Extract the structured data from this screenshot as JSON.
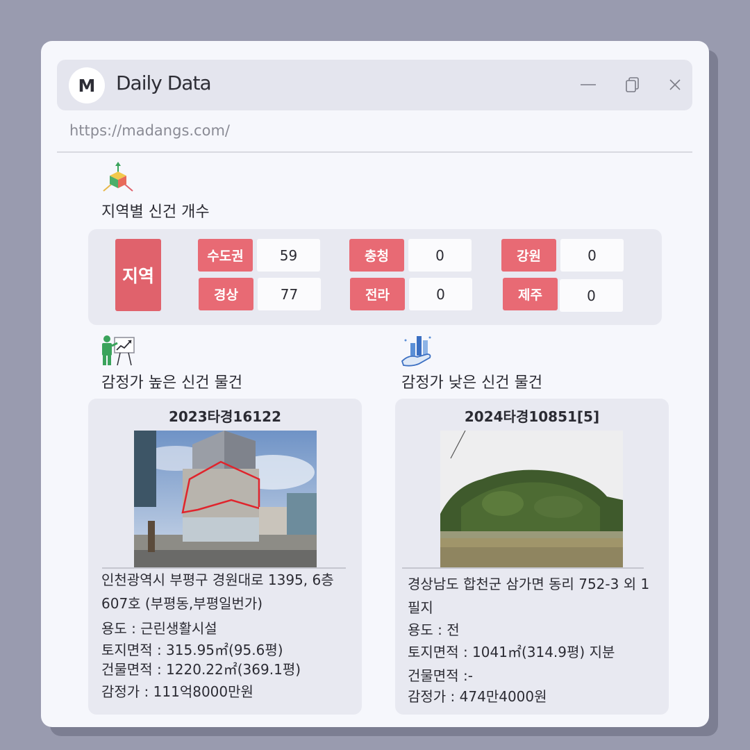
{
  "window": {
    "logo_letter": "M",
    "title": "Daily Data",
    "url": "https://madangs.com/"
  },
  "region_section": {
    "title": "지역별 신건 개수",
    "main_label": "지역",
    "regions": [
      {
        "label": "수도권",
        "value": "59"
      },
      {
        "label": "충청",
        "value": "0"
      },
      {
        "label": "강원",
        "value": "0"
      },
      {
        "label": "경상",
        "value": "77"
      },
      {
        "label": "전라",
        "value": "0"
      },
      {
        "label": "제주",
        "value": "0"
      }
    ]
  },
  "high_section": {
    "title": "감정가 높은 신건 물건",
    "case_no": "2023타경16122",
    "address_line1": "인천광역시 부평구 경원대로 1395, 6층",
    "address_line2": "607호 (부평동,부평일번가)",
    "usage": "용도 : 근린생활시설",
    "land_area": "토지면적 : 315.95㎡(95.6평)",
    "building_area": "건물면적 : 1220.22㎡(369.1평)",
    "appraisal": "감정가 : 111억8000만원"
  },
  "low_section": {
    "title": "감정가 낮은 신건 물건",
    "case_no": "2024타경10851[5]",
    "address_line1": "경상남도 합천군 삼가면 동리 752-3 외 1",
    "address_line2": "필지",
    "usage": "용도 : 전",
    "land_area": "토지면적 : 1041㎡(314.9평) 지분",
    "building_area": "건물면적 :-",
    "appraisal": "감정가 : 474만4000원"
  },
  "icons": {
    "minimize": "minimize-icon",
    "restore": "copy-window-icon",
    "close": "close-icon",
    "region": "3d-axis-cube-icon",
    "high": "presenter-chart-icon",
    "low": "hand-bar-chart-icon"
  },
  "colors": {
    "accent_red": "#e0626c",
    "label_red": "#e86a74",
    "panel_bg": "#e8e9f1",
    "page_bg": "#999baf"
  }
}
